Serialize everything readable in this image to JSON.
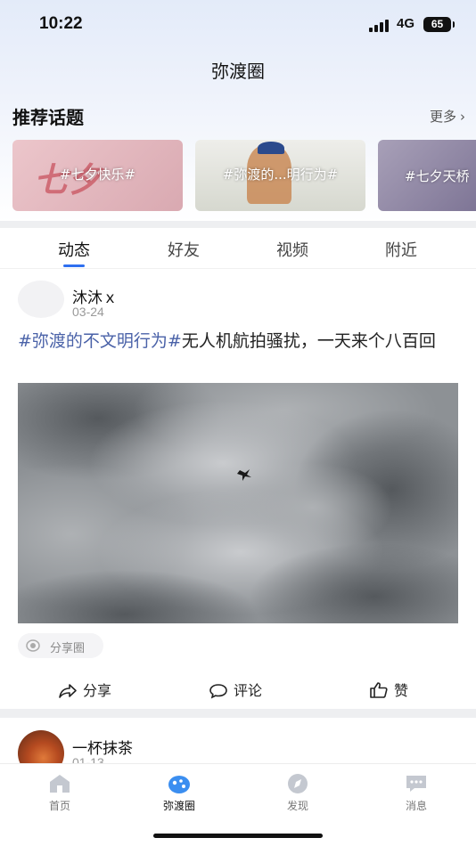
{
  "status": {
    "time": "10:22",
    "network": "4G",
    "battery": "65"
  },
  "nav": {
    "title": "弥渡圈"
  },
  "topics": {
    "heading": "推荐话题",
    "more": "更多",
    "cards": [
      {
        "label": "#七夕快乐#"
      },
      {
        "label": "#弥渡的...明行为#"
      },
      {
        "label": "#七夕天桥"
      }
    ]
  },
  "tabs": [
    {
      "label": "动态"
    },
    {
      "label": "好友"
    },
    {
      "label": "视频"
    },
    {
      "label": "附近"
    }
  ],
  "post": {
    "author": "沐沐ｘ",
    "date": "03-24",
    "tag": "#弥渡的不文明行为#",
    "text": "无人机航拍骚扰，一天来个八百回",
    "share_circle": "分享圈",
    "actions": {
      "share": "分享",
      "comment": "评论",
      "like": "赞"
    }
  },
  "post2": {
    "author": "一杯抹茶",
    "date": "01-13"
  },
  "bottom_nav": [
    {
      "label": "首页",
      "icon": "home-icon"
    },
    {
      "label": "弥渡圈",
      "icon": "circle-planet-icon"
    },
    {
      "label": "发现",
      "icon": "compass-icon"
    },
    {
      "label": "消息",
      "icon": "message-icon"
    }
  ],
  "colors": {
    "accent": "#2e6ff0",
    "tag": "#4a62a8"
  }
}
